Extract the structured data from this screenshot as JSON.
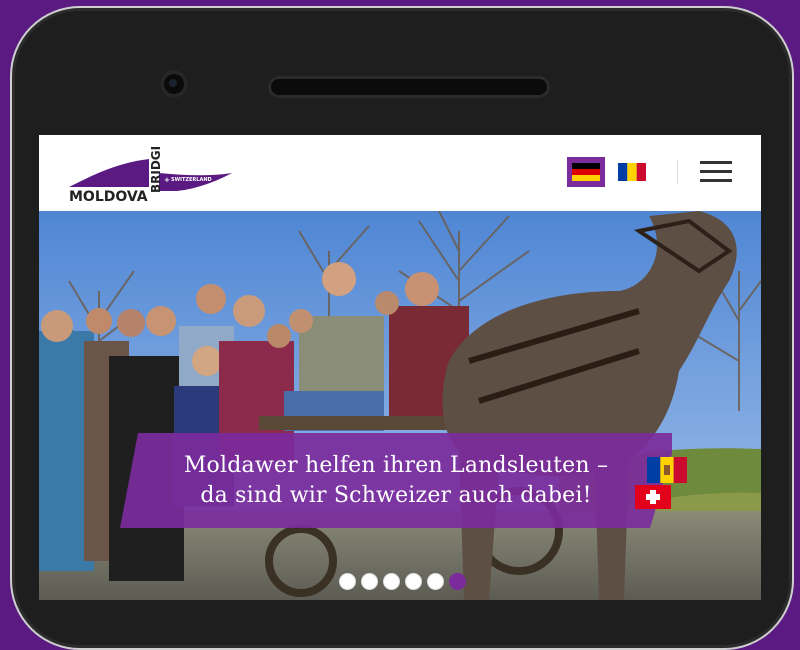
{
  "site": {
    "logo": {
      "word1": "MOLDOVA",
      "word2": "BRIDGE",
      "word3": "SWITZERLAND"
    },
    "languages": [
      {
        "code": "de",
        "icon": "german-flag-icon",
        "active": true
      },
      {
        "code": "md",
        "icon": "moldovan-flag-icon",
        "active": false
      }
    ],
    "menu_icon": "hamburger-menu-icon"
  },
  "hero": {
    "headline_line1": "Moldawer helfen ihren Landsleuten –",
    "headline_line2": "da sind wir Schweizer auch dabei!",
    "banner_flags": [
      "moldovan-flag-icon",
      "swiss-flag-icon"
    ],
    "slides_total": 6,
    "active_slide": 6
  },
  "colors": {
    "brand_purple": "#7b2b9c",
    "frame": "#5a1a82"
  }
}
